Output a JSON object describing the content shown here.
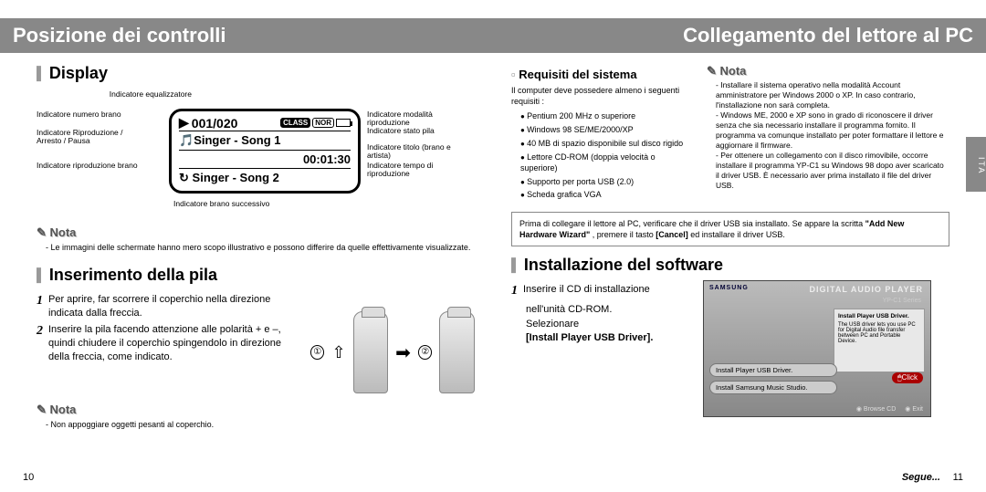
{
  "left": {
    "title": "Posizione dei controlli",
    "section_display": "Display",
    "callouts": {
      "eq": "Indicatore equalizzatore",
      "track_num": "Indicatore numero brano",
      "play_pause": "Indicatore Riproduzione / Arresto / Pausa",
      "track_rep": "Indicatore riproduzione brano",
      "next_track": "Indicatore brano successivo",
      "play_mode": "Indicatore modalità riproduzione",
      "battery": "Indicatore stato pila",
      "title_artist": "Indicatore titolo (brano e artista)",
      "play_time": "Indicatore tempo di riproduzione"
    },
    "lcd": {
      "counter": "001/020",
      "eq_badge": "CLASS",
      "nor_badge": "NOR",
      "line1_left_icon": "▶",
      "line2_left_icon": "🎵",
      "line2_text": "Singer - Song 1",
      "line3_text": "00:01:30",
      "line4_icon": "↻",
      "line4_text": "Singer - Song 2"
    },
    "nota1_label": "Nota",
    "nota1_items": [
      "Le immagini delle schermate hanno mero scopo illustrativo e possono differire da quelle effettivamente visualizzate."
    ],
    "section_battery": "Inserimento della pila",
    "steps": [
      {
        "n": "1",
        "t": "Per aprire, far scorrere il coperchio nella direzione indicata dalla freccia."
      },
      {
        "n": "2",
        "t": "Inserire la pila facendo attenzione alle polarità + e –, quindi chiudere il coperchio spingendolo in direzione della freccia, come indicato."
      }
    ],
    "nota2_label": "Nota",
    "nota2_items": [
      "Non appoggiare oggetti pesanti al coperchio."
    ],
    "page_num": "10"
  },
  "right": {
    "title": "Collegamento del lettore al PC",
    "ita_tab": "ITA",
    "req_h": "Requisiti del sistema",
    "req_intro": "Il computer deve possedere almeno i seguenti requisiti :",
    "req_items": [
      "Pentium 200 MHz o superiore",
      "Windows 98 SE/ME/2000/XP",
      "40 MB di spazio disponibile sul disco rigido",
      "Lettore CD-ROM (doppia velocità o superiore)",
      "Supporto per porta USB (2.0)",
      "Scheda grafica VGA"
    ],
    "nota_r_label": "Nota",
    "nota_r_items": [
      "Installare il sistema operativo nella modalità Account amministratore per Windows 2000 o XP. In caso contrario, l'installazione non sarà completa.",
      "Windows ME, 2000 e XP sono in grado di riconoscere il driver senza che sia necessario installare il programma fornito. Il programma va comunque installato per poter formattare il lettore e aggiornare il firmware.",
      "Per ottenere un collegamento con il disco rimovibile, occorre installare il programma YP-C1 su Windows 98 dopo aver scaricato il driver USB. È necessario aver prima installato il file del driver USB."
    ],
    "pre_connect_box_1": "Prima di collegare il lettore al PC, verificare che il driver USB sia installato. Se appare la scritta ",
    "pre_connect_bold1": "\"Add New Hardware Wizard\"",
    "pre_connect_mid": ", premere il tasto ",
    "pre_connect_bold2": "[Cancel]",
    "pre_connect_end": " ed installare il driver USB.",
    "section_install": "Installazione del software",
    "install_step_n": "1",
    "install_step_t1": "Inserire il CD di installazione",
    "install_step_t2": "nell'unità CD-ROM.",
    "install_step_t3": "Selezionare",
    "install_step_bold": "[Install Player USB Driver].",
    "screenshot": {
      "brand": "SAMSUNG",
      "product": "DIGITAL AUDIO PLAYER",
      "model": "YP-C1 Series",
      "panel_title": "Install Player USB Driver.",
      "panel_body": "The USB driver lets you use PC for Digital Audio file transfer between PC and Portable Device.",
      "btn1": "Install Player USB Driver.",
      "btn2": "Install Samsung Music Studio.",
      "click": "Click",
      "foot1": "◉ Browse CD",
      "foot2": "◉ Exit"
    },
    "segue": "Segue...",
    "page_num": "11"
  }
}
